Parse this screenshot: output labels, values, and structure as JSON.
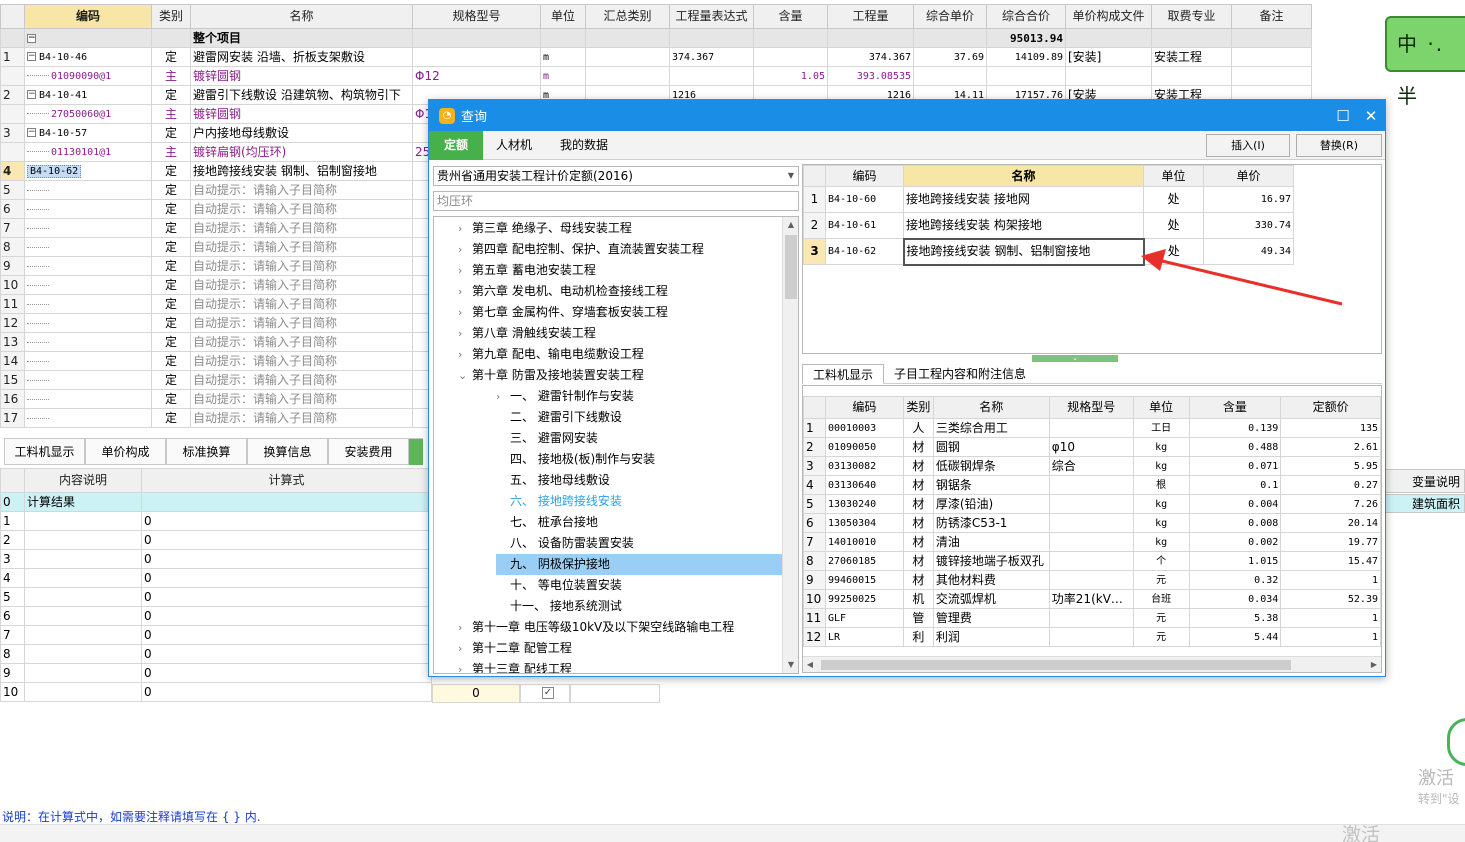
{
  "main_grid": {
    "headers": [
      "编码",
      "类别",
      "名称",
      "规格型号",
      "单位",
      "汇总类别",
      "工程量表达式",
      "含量",
      "工程量",
      "综合单价",
      "综合合价",
      "单价构成文件",
      "取费专业",
      "备注"
    ],
    "total_row": {
      "expander": "−",
      "name": "整个项目",
      "total": "95013.94"
    },
    "rows": [
      {
        "no": "1",
        "code": "B4-10-46",
        "type": "定",
        "name": "避雷网安装 沿墙、折板支架敷设",
        "spec": "",
        "unit": "m",
        "expr": "374.367",
        "content": "",
        "qty": "374.367",
        "price": "37.69",
        "amount": "14109.89",
        "file": "[安装]",
        "fee": "安装工程"
      },
      {
        "no": "",
        "code": "01090090@1",
        "type": "主",
        "name": "镀锌圆钢",
        "spec": "Φ12",
        "unit": "m",
        "expr": "",
        "content": "1.05",
        "qty": "393.08535",
        "price": "",
        "amount": "",
        "file": "",
        "fee": ""
      },
      {
        "no": "2",
        "code": "B4-10-41",
        "type": "定",
        "name": "避雷引下线敷设 沿建筑物、构筑物引下",
        "spec": "",
        "unit": "m",
        "expr": "1216",
        "content": "",
        "qty": "1216",
        "price": "14.11",
        "amount": "17157.76",
        "file": "[安装",
        "fee": "安装工程"
      },
      {
        "no": "",
        "code": "27050060@1",
        "type": "主",
        "name": "镀锌圆钢",
        "spec": "Φ1",
        "unit": "",
        "expr": "",
        "content": "",
        "qty": "",
        "price": "",
        "amount": "",
        "file": "",
        "fee": ""
      },
      {
        "no": "3",
        "code": "B4-10-57",
        "type": "定",
        "name": "户内接地母线敷设",
        "spec": "",
        "unit": "",
        "expr": "",
        "content": "",
        "qty": "",
        "price": "",
        "amount": "",
        "file": "",
        "fee": ""
      },
      {
        "no": "",
        "code": "01130101@1",
        "type": "主",
        "name": "镀锌扁钢(均压环)",
        "spec": "25",
        "unit": "",
        "expr": "",
        "content": "",
        "qty": "",
        "price": "",
        "amount": "",
        "file": "",
        "fee": ""
      },
      {
        "no": "4",
        "code": "B4-10-62",
        "type": "定",
        "name": "接地跨接线安装 钢制、铝制窗接地",
        "spec": "",
        "unit": "",
        "expr": "",
        "content": "",
        "qty": "",
        "price": "",
        "amount": "",
        "file": "",
        "fee": ""
      }
    ],
    "empty_rows": [
      "5",
      "6",
      "7",
      "8",
      "9",
      "10",
      "11",
      "12",
      "13",
      "14",
      "15",
      "16",
      "17"
    ],
    "empty_type": "定",
    "hint": "自动提示：请输入子目简称"
  },
  "bottom_tabs": [
    "工料机显示",
    "单价构成",
    "标准换算",
    "换算信息",
    "安装费用"
  ],
  "calc_grid": {
    "headers": [
      "内容说明",
      "计算式"
    ],
    "result_label": "计算结果",
    "rows": [
      "1",
      "2",
      "3",
      "4",
      "5",
      "6",
      "7",
      "8",
      "9",
      "10"
    ],
    "formula": "0",
    "var_header": "变量说明",
    "var_value": "建筑面积"
  },
  "below_dialog_value": "0",
  "note": "说明：在计算式中，如需要注释请填写在 { } 内.",
  "watermark": {
    "line1": "激活",
    "line2": "转到\"设",
    "line3": "激活 Windows"
  },
  "ime": "中 ·. 半",
  "dialog": {
    "title": "查询",
    "tabs": [
      "定额",
      "人材机",
      "我的数据"
    ],
    "insert_label": "插入(I)",
    "replace_label": "替换(R)",
    "library": "贵州省通用安装工程计价定额(2016)",
    "search": "均压环",
    "tree": [
      {
        "label": "第三章 绝缘子、母线安装工程",
        "level": 1,
        "chev": "›"
      },
      {
        "label": "第四章 配电控制、保护、直流装置安装工程",
        "level": 1,
        "chev": "›"
      },
      {
        "label": "第五章 蓄电池安装工程",
        "level": 1,
        "chev": "›"
      },
      {
        "label": "第六章 发电机、电动机检查接线工程",
        "level": 1,
        "chev": "›"
      },
      {
        "label": "第七章 金属构件、穿墙套板安装工程",
        "level": 1,
        "chev": "›"
      },
      {
        "label": "第八章 滑触线安装工程",
        "level": 1,
        "chev": "›"
      },
      {
        "label": "第九章 配电、输电电缆敷设工程",
        "level": 1,
        "chev": "›"
      },
      {
        "label": "第十章 防雷及接地装置安装工程",
        "level": 1,
        "chev": "⌄"
      },
      {
        "label": "一、 避雷针制作与安装",
        "level": 2,
        "chev": "›"
      },
      {
        "label": "二、 避雷引下线敷设",
        "level": 2,
        "chev": ""
      },
      {
        "label": "三、 避雷网安装",
        "level": 2,
        "chev": ""
      },
      {
        "label": "四、 接地极(板)制作与安装",
        "level": 2,
        "chev": ""
      },
      {
        "label": "五、 接地母线敷设",
        "level": 2,
        "chev": ""
      },
      {
        "label": "六、 接地跨接线安装",
        "level": 2,
        "chev": "",
        "state": "hl"
      },
      {
        "label": "七、 桩承台接地",
        "level": 2,
        "chev": ""
      },
      {
        "label": "八、 设备防雷装置安装",
        "level": 2,
        "chev": ""
      },
      {
        "label": "九、 阴极保护接地",
        "level": 2,
        "chev": "",
        "state": "sel"
      },
      {
        "label": "十、 等电位装置安装",
        "level": 2,
        "chev": ""
      },
      {
        "label": "十一、 接地系统测试",
        "level": 2,
        "chev": ""
      },
      {
        "label": "第十一章 电压等级10kV及以下架空线路输电工程",
        "level": 1,
        "chev": "›"
      },
      {
        "label": "第十二章 配管工程",
        "level": 1,
        "chev": "›"
      },
      {
        "label": "第十三章 配线工程",
        "level": 1,
        "chev": "›"
      }
    ],
    "quota_headers": [
      "编码",
      "名称",
      "单位",
      "单价"
    ],
    "quota_rows": [
      {
        "no": "1",
        "code": "B4-10-60",
        "name": "接地跨接线安装 接地网",
        "unit": "处",
        "price": "16.97"
      },
      {
        "no": "2",
        "code": "B4-10-61",
        "name": "接地跨接线安装 构架接地",
        "unit": "处",
        "price": "330.74"
      },
      {
        "no": "3",
        "code": "B4-10-62",
        "name": "接地跨接线安装 钢制、铝制窗接地",
        "unit": "处",
        "price": "49.34"
      }
    ],
    "sub_tabs": [
      "工料机显示",
      "子目工程内容和附注信息"
    ],
    "res_headers": [
      "编码",
      "类别",
      "名称",
      "规格型号",
      "单位",
      "含量",
      "定额价"
    ],
    "res_rows": [
      {
        "no": "1",
        "code": "00010003",
        "type": "人",
        "name": "三类综合用工",
        "spec": "",
        "unit": "工日",
        "content": "0.139",
        "price": "135"
      },
      {
        "no": "2",
        "code": "01090050",
        "type": "材",
        "name": "圆钢",
        "spec": "φ10",
        "unit": "kg",
        "content": "0.488",
        "price": "2.61"
      },
      {
        "no": "3",
        "code": "03130082",
        "type": "材",
        "name": "低碳钢焊条",
        "spec": "综合",
        "unit": "kg",
        "content": "0.071",
        "price": "5.95"
      },
      {
        "no": "4",
        "code": "03130640",
        "type": "材",
        "name": "钢锯条",
        "spec": "",
        "unit": "根",
        "content": "0.1",
        "price": "0.27"
      },
      {
        "no": "5",
        "code": "13030240",
        "type": "材",
        "name": "厚漆(铅油)",
        "spec": "",
        "unit": "kg",
        "content": "0.004",
        "price": "7.26"
      },
      {
        "no": "6",
        "code": "13050304",
        "type": "材",
        "name": "防锈漆C53-1",
        "spec": "",
        "unit": "kg",
        "content": "0.008",
        "price": "20.14"
      },
      {
        "no": "7",
        "code": "14010010",
        "type": "材",
        "name": "清油",
        "spec": "",
        "unit": "kg",
        "content": "0.002",
        "price": "19.77"
      },
      {
        "no": "8",
        "code": "27060185",
        "type": "材",
        "name": "镀锌接地端子板双孔",
        "spec": "",
        "unit": "个",
        "content": "1.015",
        "price": "15.47"
      },
      {
        "no": "9",
        "code": "99460015",
        "type": "材",
        "name": "其他材料费",
        "spec": "",
        "unit": "元",
        "content": "0.32",
        "price": "1"
      },
      {
        "no": "10",
        "code": "99250025",
        "type": "机",
        "name": "交流弧焊机",
        "spec": "功率21(kV…",
        "unit": "台班",
        "content": "0.034",
        "price": "52.39"
      },
      {
        "no": "11",
        "code": "GLF",
        "type": "管",
        "name": "管理费",
        "spec": "",
        "unit": "元",
        "content": "5.38",
        "price": "1"
      },
      {
        "no": "12",
        "code": "LR",
        "type": "利",
        "name": "利润",
        "spec": "",
        "unit": "元",
        "content": "5.44",
        "price": "1"
      }
    ]
  },
  "colors": {
    "accent": "#1a8ee6",
    "green": "#46b04a",
    "arrow": "#e8302a",
    "purple": "#8b1c8b"
  }
}
